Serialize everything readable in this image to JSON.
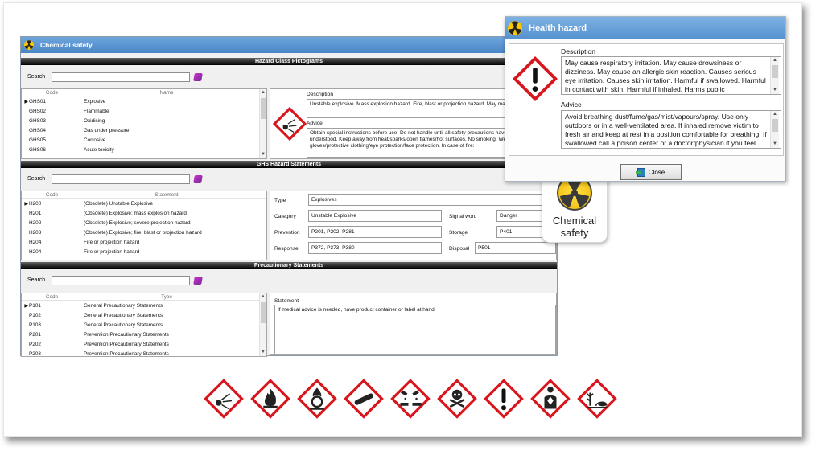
{
  "main_window": {
    "title": "Chemical safety",
    "sections": {
      "pictograms": {
        "header": "Hazard Class Pictograms",
        "search_label": "Search",
        "search_value": "",
        "columns": [
          "Code",
          "Name"
        ],
        "rows": [
          {
            "code": "GHS01",
            "name": "Explosive"
          },
          {
            "code": "GHS02",
            "name": "Flammable"
          },
          {
            "code": "GHS03",
            "name": "Oxidising"
          },
          {
            "code": "GHS04",
            "name": "Gas under pressure"
          },
          {
            "code": "GHS05",
            "name": "Corrosive"
          },
          {
            "code": "GHS06",
            "name": "Acute toxicity"
          }
        ],
        "description_label": "Description",
        "description_text": "Unstable explosive. Mass explosion hazard. Fire, blast or projection hazard. May mass explode in fire.",
        "advice_label": "Advice",
        "advice_text": "Obtain special instructions before use. Do not handle until all safety precautions have been read and understood. Keep away from heat/sparks/open flames/hot surfaces. No smoking. Wear protective gloves/protective clothing/eye protection/face protection. In case of fire:"
      },
      "statements": {
        "header": "GHS Hazard Statements",
        "search_label": "Search",
        "search_value": "",
        "columns": [
          "Code",
          "Statement"
        ],
        "rows": [
          {
            "code": "H200",
            "text": "(Obsolete) Unstable Explosive"
          },
          {
            "code": "H201",
            "text": "(Obsolete) Explosive; mass explosion hazard"
          },
          {
            "code": "H202",
            "text": "(Obsolete) Explosive; severe projection hazard"
          },
          {
            "code": "H203",
            "text": "(Obsolete) Explosive; fire, blast or projection hazard"
          },
          {
            "code": "H204",
            "text": "Fire or projection hazard"
          },
          {
            "code": "H204",
            "text": "Fire or projection hazard"
          }
        ],
        "fields": {
          "type_label": "Type",
          "type_value": "Explosives",
          "category_label": "Category",
          "category_value": "Unstable Explosive",
          "signal_label": "Signal word",
          "signal_value": "Danger",
          "prevention_label": "Prevention",
          "prevention_value": "P201, P202, P281",
          "storage_label": "Storage",
          "storage_value": "P401",
          "response_label": "Response",
          "response_value": "P372, P373, P380",
          "disposal_label": "Disposal",
          "disposal_value": "P501"
        }
      },
      "precautionary": {
        "header": "Precautionary Statements",
        "search_label": "Search",
        "search_value": "",
        "columns": [
          "Code",
          "Type"
        ],
        "rows": [
          {
            "code": "P101",
            "type": "General Precautionary Statements"
          },
          {
            "code": "P102",
            "type": "General Precautionary Statements"
          },
          {
            "code": "P103",
            "type": "General Precautionary Statements"
          },
          {
            "code": "P201",
            "type": "Prevention Precautionary Statements"
          },
          {
            "code": "P202",
            "type": "Prevention Precautionary Statements"
          },
          {
            "code": "P203",
            "type": "Prevention Precautionary Statements"
          }
        ],
        "statement_label": "Statement",
        "statement_text": "If medical advice is needed, have product container or label at hand."
      }
    }
  },
  "health_dialog": {
    "title": "Health hazard",
    "description_label": "Description",
    "description_text": "May cause respiratory irritation. May cause drowsiness or dizziness. May cause an allergic skin reaction. Causes serious eye irritation. Causes skin irritation. Harmful if swallowed. Harmful in contact with skin. Harmful if inhaled. Harms public",
    "advice_label": "Advice",
    "advice_text": "Avoid breathing dust/fume/gas/mist/vapours/spray. Use only outdoors or in a well-ventilated area. If inhaled remove victim to fresh air and keep at rest in a position comfortable for breathing. If swallowed call a poison center or a doctor/physician if you feel",
    "close_label": "Close"
  },
  "app_icon": {
    "label_line1": "Chemical",
    "label_line2": "safety"
  },
  "pictogram_strip": [
    "explosive-icon",
    "flammable-icon",
    "oxidising-icon",
    "gas-cylinder-icon",
    "corrosive-icon",
    "skull-icon",
    "exclamation-icon",
    "health-hazard-icon",
    "environment-icon"
  ],
  "colors": {
    "pictogram_border": "#d8161d",
    "titlebar": "#5a93cf",
    "radiation_yellow": "#fbc800"
  }
}
